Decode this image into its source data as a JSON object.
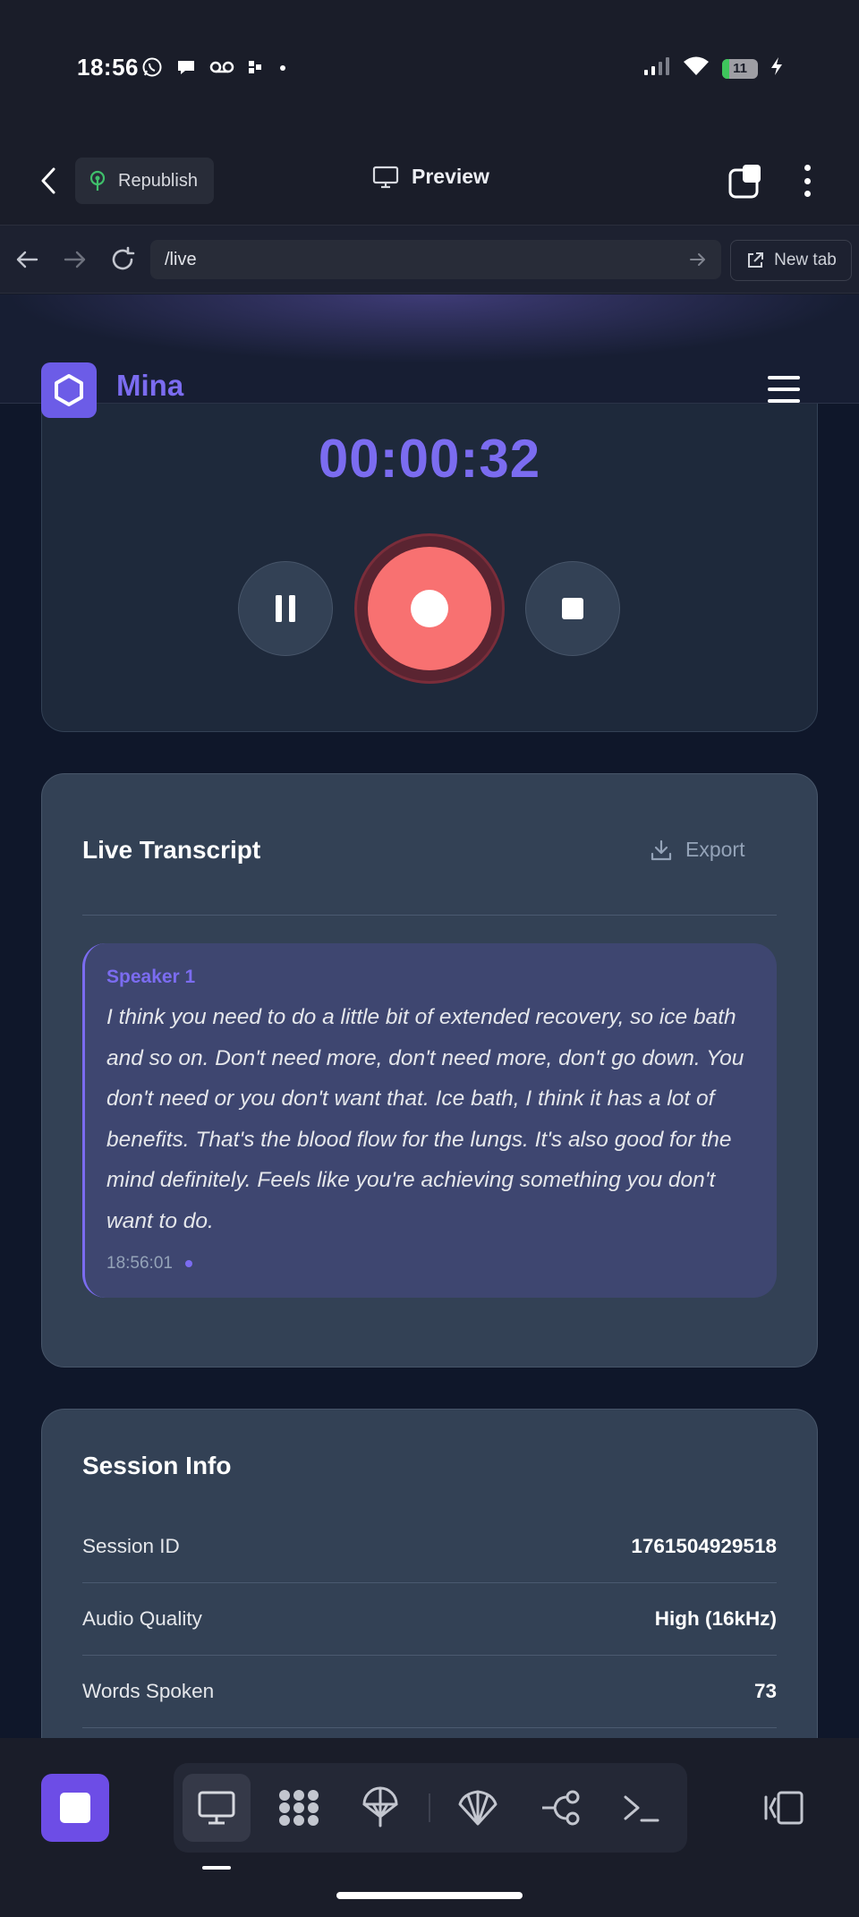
{
  "status_bar": {
    "time": "18:56",
    "battery": "11",
    "left_icons": [
      "whatsapp-icon",
      "chat-bubble-icon",
      "voicemail-icon",
      "grid-dots-icon",
      "dot-icon"
    ],
    "right_icons": [
      "signal-icon",
      "wifi-icon",
      "battery-icon",
      "charging-icon"
    ]
  },
  "app_bar": {
    "republish_label": "Republish",
    "preview_label": "Preview"
  },
  "browser": {
    "url": "/live",
    "new_tab_label": "New tab"
  },
  "site": {
    "brand": "Mina"
  },
  "recorder": {
    "timer": "00:00:32",
    "state": "recording"
  },
  "transcript": {
    "title": "Live Transcript",
    "export_label": "Export",
    "entries": [
      {
        "speaker": "Speaker 1",
        "text": "I think you need to do a little bit of extended recovery, so ice bath and so on. Don't need more, don't need more, don't go down. You don't need or you don't want that. Ice bath, I think it has a lot of benefits. That's the blood flow for the lungs. It's also good for the mind definitely. Feels like you're achieving something you don't want to do.",
        "time": "18:56:01"
      }
    ]
  },
  "session_info": {
    "title": "Session Info",
    "rows": [
      {
        "label": "Session ID",
        "value": "1761504929518"
      },
      {
        "label": "Audio Quality",
        "value": "High (16kHz)"
      },
      {
        "label": "Words Spoken",
        "value": "73"
      }
    ]
  },
  "toolbar": {
    "tools": [
      "desktop-icon",
      "grid-blob-icon",
      "parachute-icon",
      "shell-icon",
      "branch-icon",
      "terminal-icon"
    ],
    "active_tool": "desktop-icon"
  },
  "colors": {
    "accent": "#7b6cf0",
    "record": "#f87171",
    "card": "#334155",
    "page_bg": "#0f172a"
  }
}
